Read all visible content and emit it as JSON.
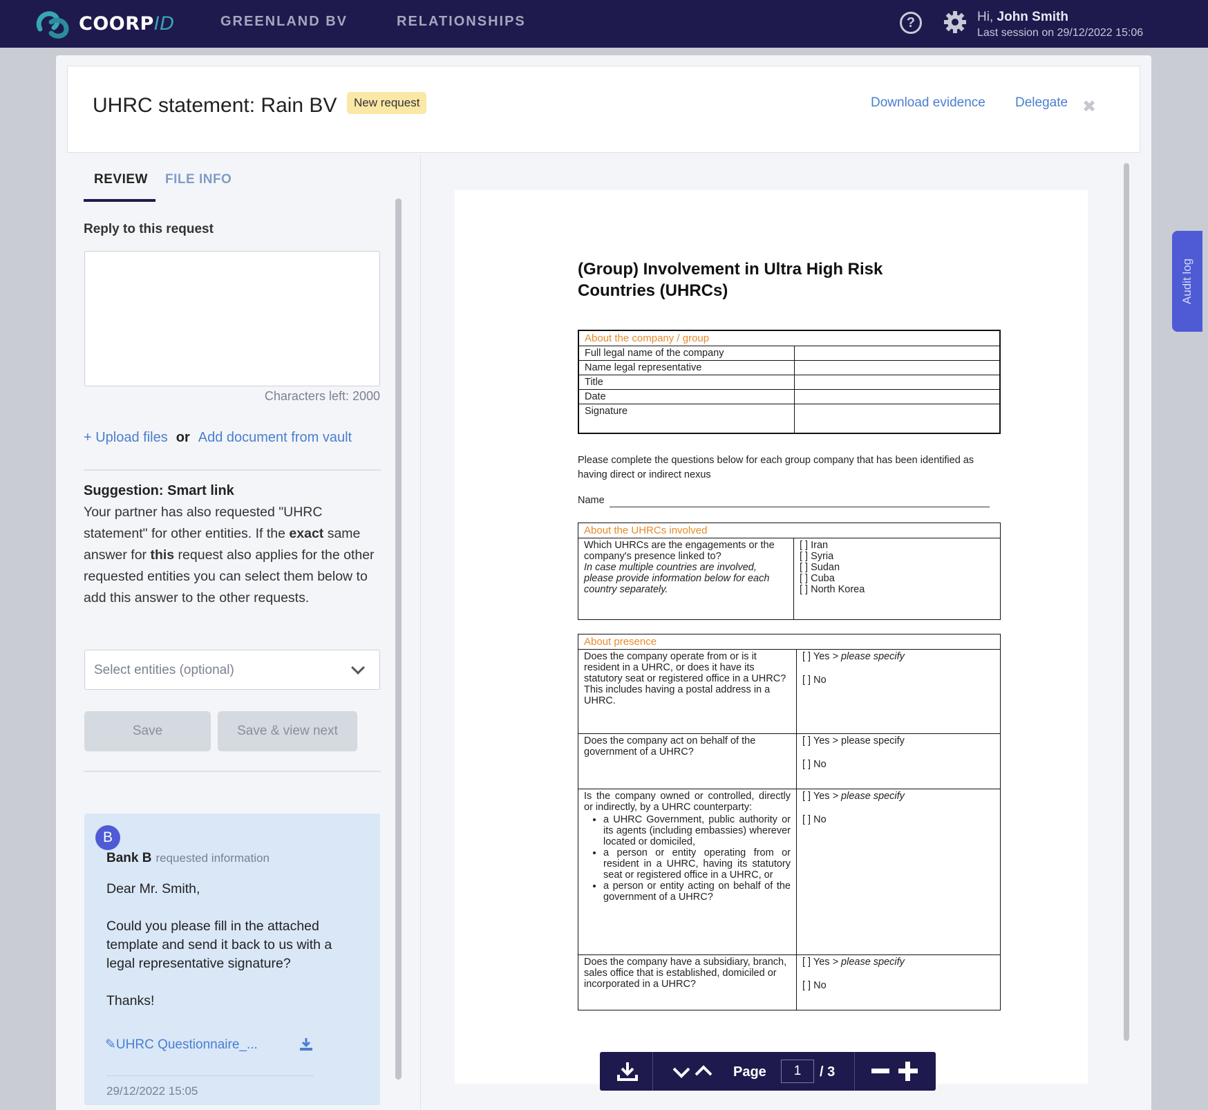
{
  "nav": {
    "logo_main": "COORP",
    "logo_id": "ID",
    "link_company": "GREENLAND BV",
    "link_relationships": "RELATIONSHIPS",
    "help_glyph": "?",
    "user_greeting": "Hi,",
    "user_name": "John Smith",
    "last_session": "Last session on  29/12/2022 15:06",
    "colors": {
      "bar": "#1e1a4e",
      "accent": "#38a6b4"
    }
  },
  "header": {
    "title": "UHRC statement: Rain BV",
    "badge": "New request",
    "download_evidence": "Download evidence",
    "delegate": "Delegate",
    "close_glyph": "✖"
  },
  "left": {
    "tab_review": "REVIEW",
    "tab_file_info": "FILE INFO",
    "reply_label": "Reply to this request",
    "reply_value": "",
    "characters_left": "Characters left: 2000",
    "upload_files": "+ Upload files",
    "or": "or",
    "add_from_vault": "Add document from vault",
    "suggestion_title": "Suggestion: Smart link",
    "suggestion_p1": "Your partner has also requested \"UHRC statement\" for other entities. If the ",
    "suggestion_exact": "exact",
    "suggestion_p2": " same answer for ",
    "suggestion_this": "this",
    "suggestion_p3": " request also applies for the other requested entities you can select them below to add this answer to the other requests.",
    "select_placeholder": "Select entities (optional)",
    "save": "Save",
    "save_view_next": "Save & view next"
  },
  "message": {
    "avatar_letter": "B",
    "sender": "Bank B",
    "action": "requested information",
    "body": "Dear Mr. Smith,\n\nCould you please fill in the attached template and send it back to us with a legal representative signature?\n\nThanks!",
    "attachment_glyph": "✎",
    "attachment": "UHRC Questionnaire_...",
    "timestamp": "29/12/2022 15:05"
  },
  "doc": {
    "title": "(Group) Involvement in Ultra High Risk Countries (UHRCs)",
    "company_header": "About the company / group",
    "company_rows": [
      "Full legal name of the company",
      "Name legal representative",
      "Title",
      "Date",
      "Signature"
    ],
    "instructions": "Please complete the questions below for each group company that has been identified as having direct or indirect nexus",
    "name_label": "Name",
    "uhrc_header": "About the UHRCs involved",
    "uhrc_q_line1": "Which UHRCs are the engagements or the company's presence linked to?",
    "uhrc_q_line2": "In case multiple countries are involved, please provide information below for each country separately.",
    "uhrc_options": [
      "[ ] Iran",
      "[ ] Syria",
      "[ ] Sudan",
      "[ ] Cuba",
      "[ ] North Korea"
    ],
    "presence_header": "About presence",
    "q1": "Does the company operate from or is it resident in a UHRC, or does it have its statutory seat or registered office in a UHRC? This includes having a postal address in a UHRC.",
    "q2": "Does the company act on behalf of the government of a UHRC?",
    "q3_intro": "Is the company owned or controlled, directly or indirectly, by a UHRC counterparty:",
    "q3_bullets": [
      "a UHRC Government, public authority or its agents (including embassies) wherever located or domiciled,",
      "a person or entity operating from or resident in a UHRC, having its statutory seat or registered office in a UHRC, or",
      "a person or entity acting on behalf of the government of a UHRC?"
    ],
    "q4": "Does the company have a subsidiary, branch, sales office that is established, domiciled or incorporated in a UHRC?",
    "yes_specify": "[ ] Yes  > please specify",
    "yes_label": "[ ] Yes",
    "please_specify": "> please specify",
    "no": "[ ] No"
  },
  "pdfbar": {
    "page_label": "Page",
    "page_current": "1",
    "page_total": "/ 3"
  },
  "audit": {
    "label": "Audit log"
  }
}
